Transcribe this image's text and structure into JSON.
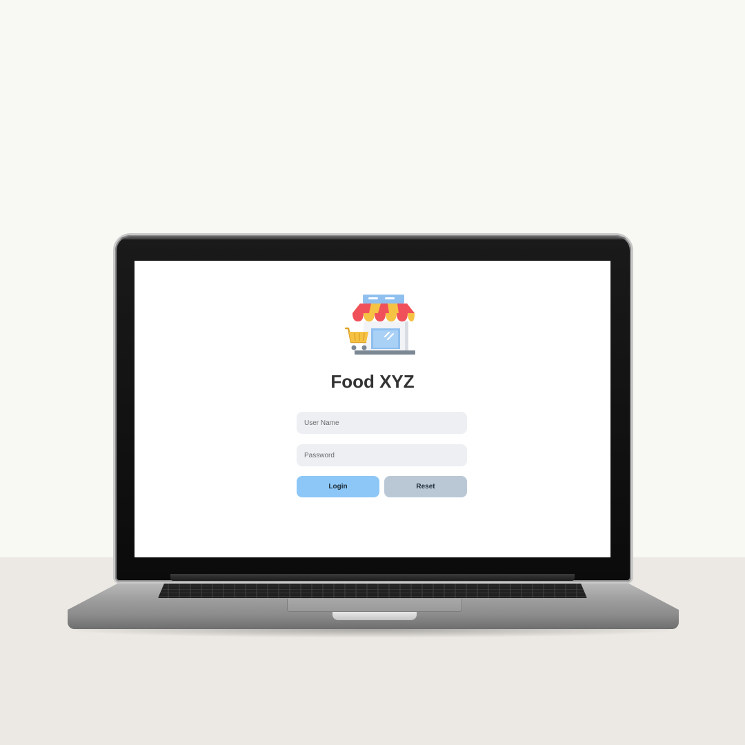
{
  "app": {
    "title": "Food XYZ",
    "logo_icon": "store-with-cart-icon"
  },
  "login_form": {
    "username": {
      "placeholder": "User Name",
      "value": ""
    },
    "password": {
      "placeholder": "Password",
      "value": ""
    },
    "login_label": "Login",
    "reset_label": "Reset"
  },
  "colors": {
    "login_button": "#8cc7f7",
    "reset_button": "#bac8d6",
    "input_background": "#edeff3",
    "title_text": "#333333",
    "awning_red": "#f0505a",
    "awning_yellow": "#f6c243",
    "cart_yellow": "#f6c243",
    "store_blue": "#8ebfef"
  }
}
